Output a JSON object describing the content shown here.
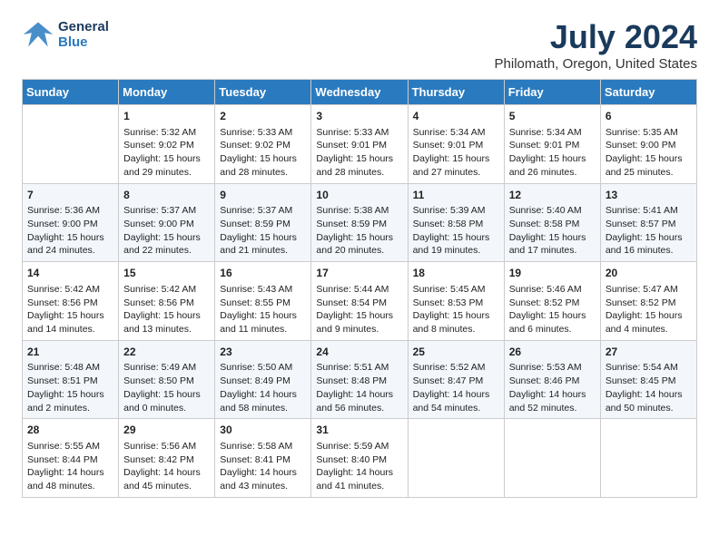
{
  "logo": {
    "line1": "General",
    "line2": "Blue"
  },
  "title": "July 2024",
  "subtitle": "Philomath, Oregon, United States",
  "headers": [
    "Sunday",
    "Monday",
    "Tuesday",
    "Wednesday",
    "Thursday",
    "Friday",
    "Saturday"
  ],
  "weeks": [
    [
      {
        "date": "",
        "info": ""
      },
      {
        "date": "1",
        "info": "Sunrise: 5:32 AM\nSunset: 9:02 PM\nDaylight: 15 hours\nand 29 minutes."
      },
      {
        "date": "2",
        "info": "Sunrise: 5:33 AM\nSunset: 9:02 PM\nDaylight: 15 hours\nand 28 minutes."
      },
      {
        "date": "3",
        "info": "Sunrise: 5:33 AM\nSunset: 9:01 PM\nDaylight: 15 hours\nand 28 minutes."
      },
      {
        "date": "4",
        "info": "Sunrise: 5:34 AM\nSunset: 9:01 PM\nDaylight: 15 hours\nand 27 minutes."
      },
      {
        "date": "5",
        "info": "Sunrise: 5:34 AM\nSunset: 9:01 PM\nDaylight: 15 hours\nand 26 minutes."
      },
      {
        "date": "6",
        "info": "Sunrise: 5:35 AM\nSunset: 9:00 PM\nDaylight: 15 hours\nand 25 minutes."
      }
    ],
    [
      {
        "date": "7",
        "info": "Sunrise: 5:36 AM\nSunset: 9:00 PM\nDaylight: 15 hours\nand 24 minutes."
      },
      {
        "date": "8",
        "info": "Sunrise: 5:37 AM\nSunset: 9:00 PM\nDaylight: 15 hours\nand 22 minutes."
      },
      {
        "date": "9",
        "info": "Sunrise: 5:37 AM\nSunset: 8:59 PM\nDaylight: 15 hours\nand 21 minutes."
      },
      {
        "date": "10",
        "info": "Sunrise: 5:38 AM\nSunset: 8:59 PM\nDaylight: 15 hours\nand 20 minutes."
      },
      {
        "date": "11",
        "info": "Sunrise: 5:39 AM\nSunset: 8:58 PM\nDaylight: 15 hours\nand 19 minutes."
      },
      {
        "date": "12",
        "info": "Sunrise: 5:40 AM\nSunset: 8:58 PM\nDaylight: 15 hours\nand 17 minutes."
      },
      {
        "date": "13",
        "info": "Sunrise: 5:41 AM\nSunset: 8:57 PM\nDaylight: 15 hours\nand 16 minutes."
      }
    ],
    [
      {
        "date": "14",
        "info": "Sunrise: 5:42 AM\nSunset: 8:56 PM\nDaylight: 15 hours\nand 14 minutes."
      },
      {
        "date": "15",
        "info": "Sunrise: 5:42 AM\nSunset: 8:56 PM\nDaylight: 15 hours\nand 13 minutes."
      },
      {
        "date": "16",
        "info": "Sunrise: 5:43 AM\nSunset: 8:55 PM\nDaylight: 15 hours\nand 11 minutes."
      },
      {
        "date": "17",
        "info": "Sunrise: 5:44 AM\nSunset: 8:54 PM\nDaylight: 15 hours\nand 9 minutes."
      },
      {
        "date": "18",
        "info": "Sunrise: 5:45 AM\nSunset: 8:53 PM\nDaylight: 15 hours\nand 8 minutes."
      },
      {
        "date": "19",
        "info": "Sunrise: 5:46 AM\nSunset: 8:52 PM\nDaylight: 15 hours\nand 6 minutes."
      },
      {
        "date": "20",
        "info": "Sunrise: 5:47 AM\nSunset: 8:52 PM\nDaylight: 15 hours\nand 4 minutes."
      }
    ],
    [
      {
        "date": "21",
        "info": "Sunrise: 5:48 AM\nSunset: 8:51 PM\nDaylight: 15 hours\nand 2 minutes."
      },
      {
        "date": "22",
        "info": "Sunrise: 5:49 AM\nSunset: 8:50 PM\nDaylight: 15 hours\nand 0 minutes."
      },
      {
        "date": "23",
        "info": "Sunrise: 5:50 AM\nSunset: 8:49 PM\nDaylight: 14 hours\nand 58 minutes."
      },
      {
        "date": "24",
        "info": "Sunrise: 5:51 AM\nSunset: 8:48 PM\nDaylight: 14 hours\nand 56 minutes."
      },
      {
        "date": "25",
        "info": "Sunrise: 5:52 AM\nSunset: 8:47 PM\nDaylight: 14 hours\nand 54 minutes."
      },
      {
        "date": "26",
        "info": "Sunrise: 5:53 AM\nSunset: 8:46 PM\nDaylight: 14 hours\nand 52 minutes."
      },
      {
        "date": "27",
        "info": "Sunrise: 5:54 AM\nSunset: 8:45 PM\nDaylight: 14 hours\nand 50 minutes."
      }
    ],
    [
      {
        "date": "28",
        "info": "Sunrise: 5:55 AM\nSunset: 8:44 PM\nDaylight: 14 hours\nand 48 minutes."
      },
      {
        "date": "29",
        "info": "Sunrise: 5:56 AM\nSunset: 8:42 PM\nDaylight: 14 hours\nand 45 minutes."
      },
      {
        "date": "30",
        "info": "Sunrise: 5:58 AM\nSunset: 8:41 PM\nDaylight: 14 hours\nand 43 minutes."
      },
      {
        "date": "31",
        "info": "Sunrise: 5:59 AM\nSunset: 8:40 PM\nDaylight: 14 hours\nand 41 minutes."
      },
      {
        "date": "",
        "info": ""
      },
      {
        "date": "",
        "info": ""
      },
      {
        "date": "",
        "info": ""
      }
    ]
  ]
}
